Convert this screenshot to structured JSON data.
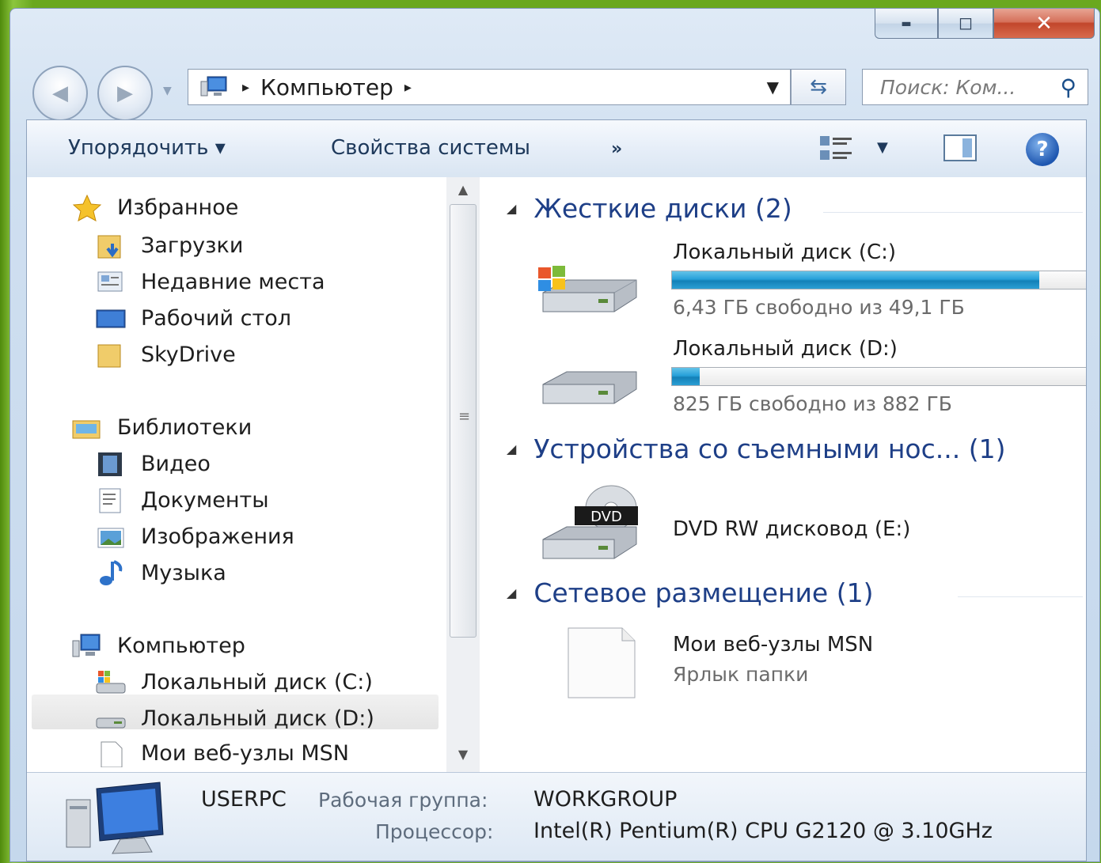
{
  "window": {
    "caption": {
      "minimize": "▬",
      "maximize": "◻",
      "close": "✕"
    }
  },
  "address": {
    "location": "Компьютер",
    "separator": "▸"
  },
  "search": {
    "placeholder": "Поиск: Ком..."
  },
  "toolbar": {
    "organize": "Упорядочить ▾",
    "system_properties": "Свойства системы",
    "more": "»"
  },
  "nav": {
    "favorites": "Избранное",
    "downloads": "Загрузки",
    "recent": "Недавние места",
    "desktop": "Рабочий стол",
    "skydrive": "SkyDrive",
    "libraries": "Библиотеки",
    "video": "Видео",
    "documents": "Документы",
    "pictures": "Изображения",
    "music": "Музыка",
    "computer": "Компьютер",
    "drive_c": "Локальный диск (C:)",
    "drive_d": "Локальный диск (D:)",
    "msn": "Мои веб-узлы MSN"
  },
  "main": {
    "hard_disks_header": "Жесткие диски (2)",
    "drive_c": {
      "name": "Локальный диск (C:)",
      "free": "6,43 ГБ свободно из 49,1 ГБ",
      "used_fraction": 0.869
    },
    "drive_d": {
      "name": "Локальный диск (D:)",
      "free": "825 ГБ свободно из 882 ГБ",
      "used_fraction": 0.065
    },
    "removable_header": "Устройства со съемными нос... (1)",
    "dvd": {
      "name": "DVD RW дисковод (E:)",
      "badge": "DVD"
    },
    "network_header": "Сетевое размещение (1)",
    "msn": {
      "name": "Мои веб-узлы MSN",
      "type": "Ярлык папки"
    }
  },
  "details": {
    "computer_name": "USERPC",
    "workgroup_label": "Рабочая группа:",
    "workgroup_value": "WORKGROUP",
    "processor_label": "Процессор:",
    "processor_value": "Intel(R) Pentium(R) CPU G2120 @ 3.10GHz"
  },
  "colors": {
    "accent": "#1e3f87",
    "bar_fill": "#26a0da",
    "desktop_green": "#6aa81f"
  }
}
